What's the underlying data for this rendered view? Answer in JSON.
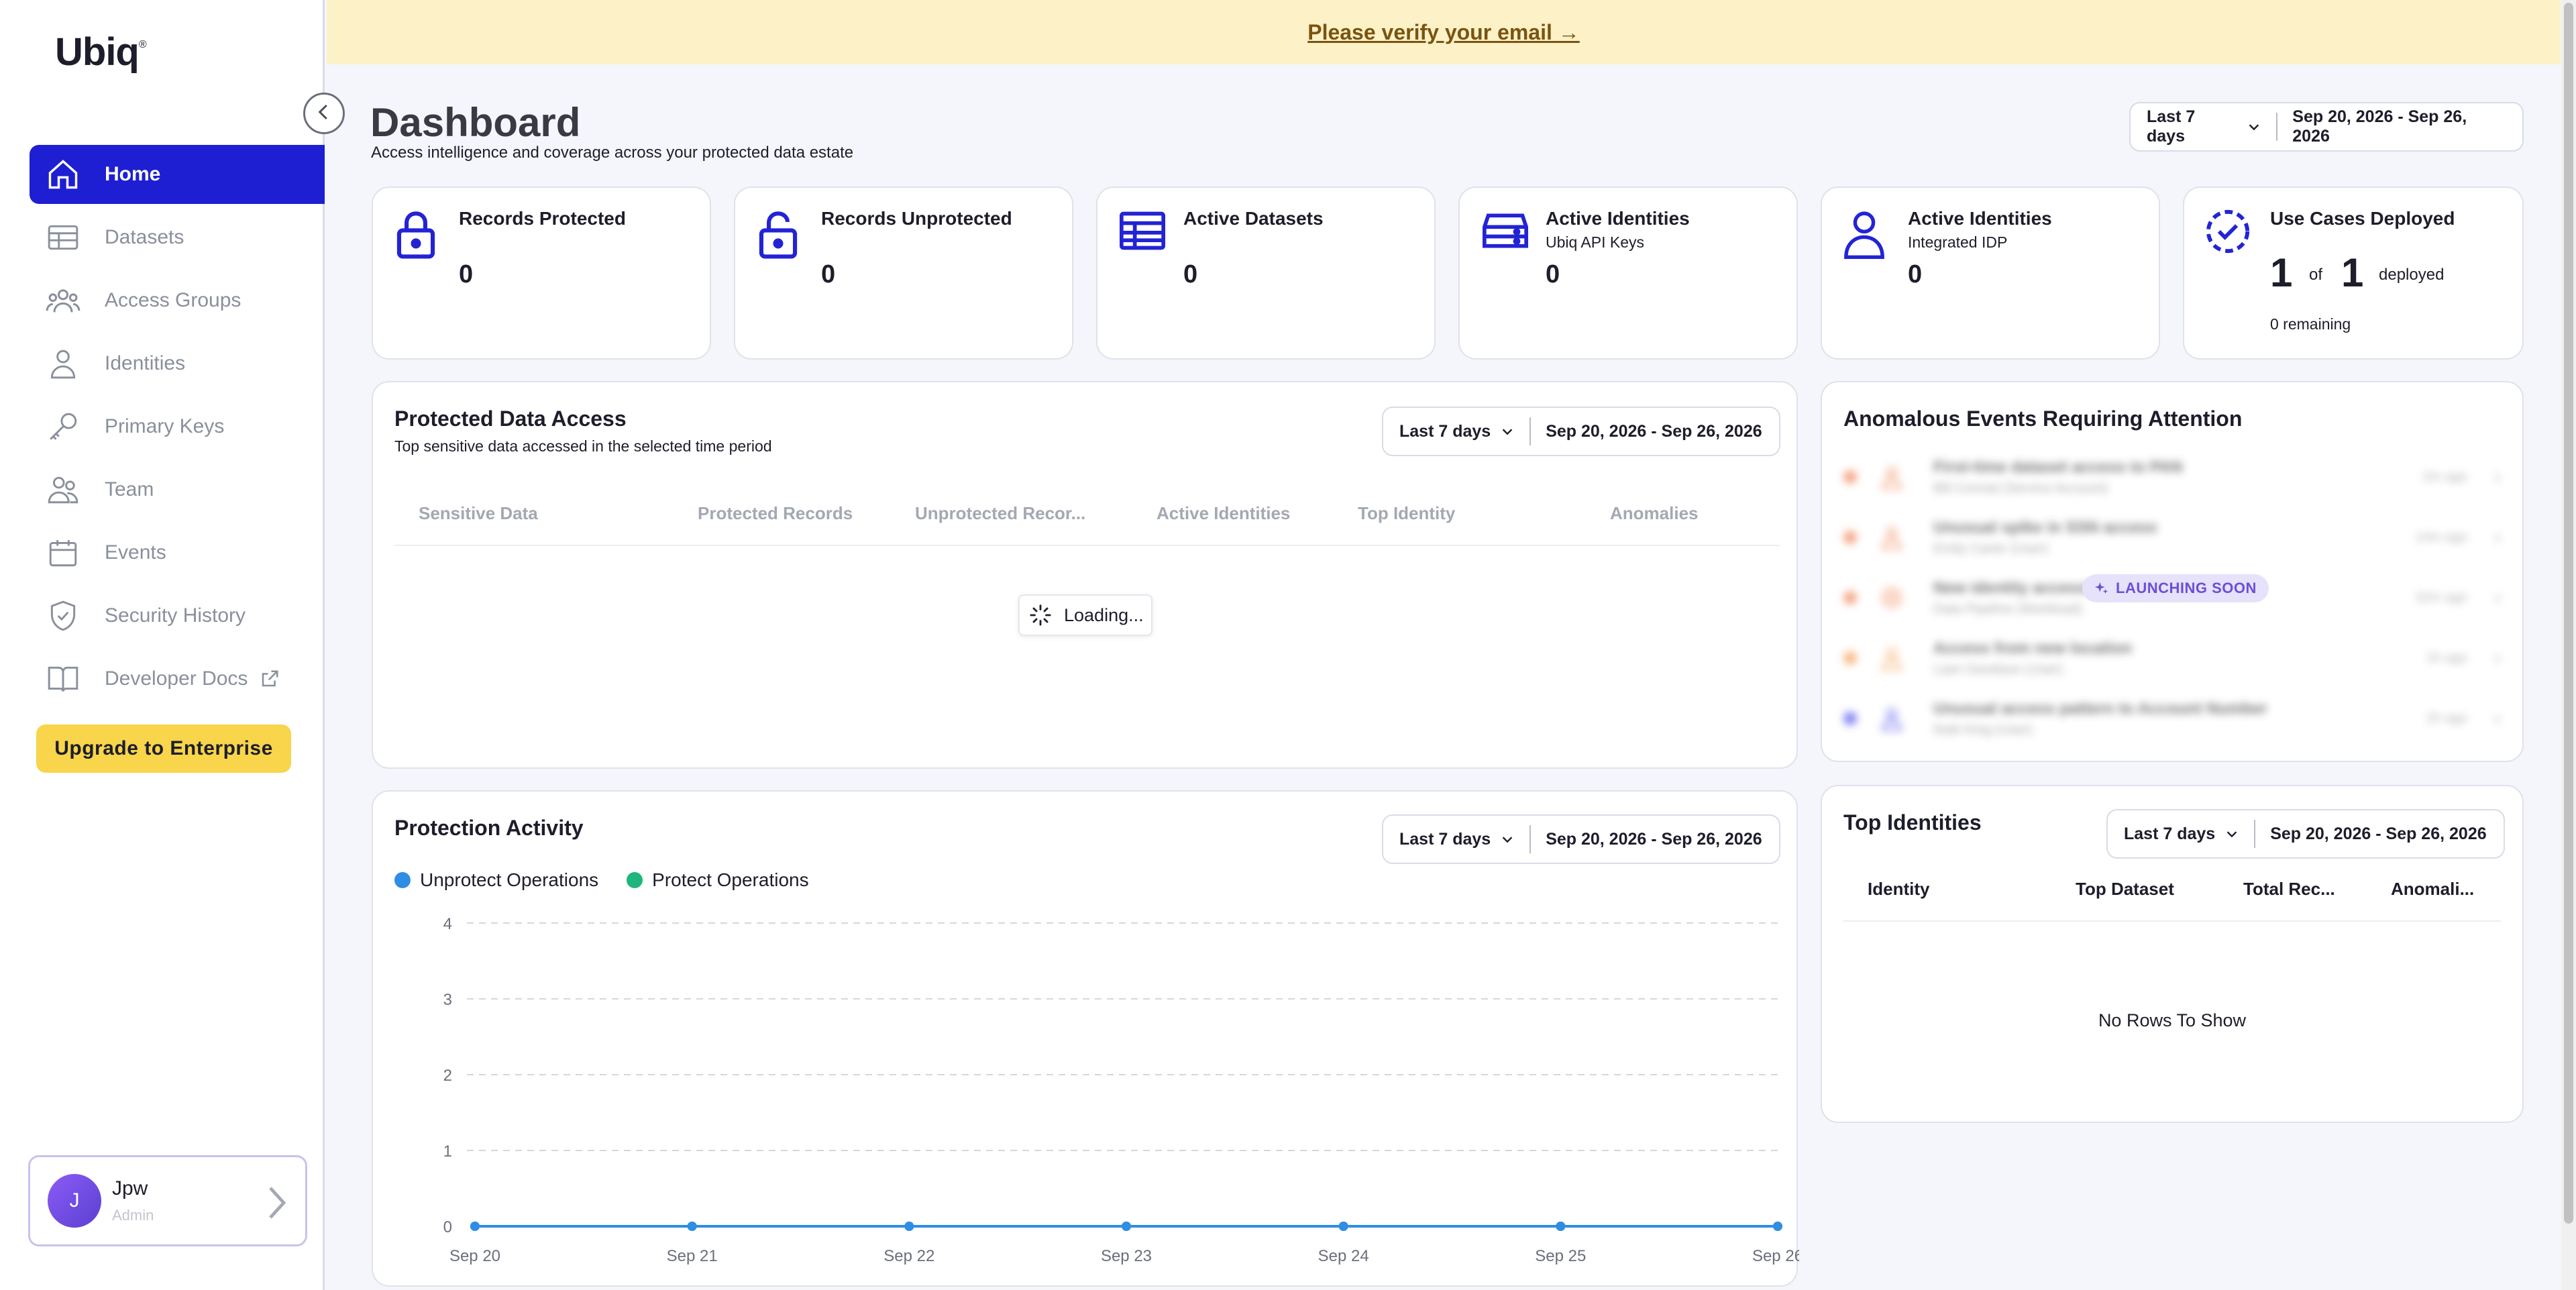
{
  "banner": {
    "text": "Please verify your email →"
  },
  "sidebar": {
    "logo": "Ubiq",
    "logo_mark": "®",
    "items": [
      {
        "label": "Home",
        "icon": "home-icon",
        "active": true
      },
      {
        "label": "Datasets",
        "icon": "table-icon"
      },
      {
        "label": "Access Groups",
        "icon": "group-icon"
      },
      {
        "label": "Identities",
        "icon": "person-icon"
      },
      {
        "label": "Primary Keys",
        "icon": "key-icon"
      },
      {
        "label": "Team",
        "icon": "team-icon"
      },
      {
        "label": "Events",
        "icon": "calendar-icon"
      },
      {
        "label": "Security History",
        "icon": "shield-check-icon"
      },
      {
        "label": "Developer Docs",
        "icon": "book-icon",
        "external": true
      }
    ],
    "upgrade_label": "Upgrade to Enterprise",
    "user": {
      "initial": "J",
      "name": "Jpw",
      "role": "Admin"
    }
  },
  "header": {
    "title": "Dashboard",
    "subtitle": "Access intelligence and coverage across your protected data estate",
    "range_preset": "Last 7 days",
    "range_dates": "Sep 20, 2026 - Sep 26, 2026"
  },
  "stats": [
    {
      "title": "Records Protected",
      "sub": "",
      "value": "0",
      "icon": "lock-icon"
    },
    {
      "title": "Records Unprotected",
      "sub": "",
      "value": "0",
      "icon": "unlock-icon"
    },
    {
      "title": "Active Datasets",
      "sub": "",
      "value": "0",
      "icon": "table-icon"
    },
    {
      "title": "Active Identities",
      "sub": "Ubiq API Keys",
      "value": "0",
      "icon": "server-icon"
    },
    {
      "title": "Active Identities",
      "sub": "Integrated IDP",
      "value": "0",
      "icon": "person-icon"
    }
  ],
  "use_cases": {
    "title": "Use Cases Deployed",
    "deployed": "1",
    "of_label": "of",
    "total": "1",
    "deployed_label": "deployed",
    "remaining": "0 remaining"
  },
  "protected_access": {
    "title": "Protected Data Access",
    "subtitle": "Top sensitive data accessed in the selected time period",
    "range_preset": "Last 7 days",
    "range_dates": "Sep 20, 2026 - Sep 26, 2026",
    "columns": [
      "Sensitive Data",
      "Protected Records",
      "Unprotected Recor...",
      "Active Identities",
      "Top Identity",
      "Anomalies"
    ],
    "loading": "Loading..."
  },
  "anomalies": {
    "title": "Anomalous Events Requiring Attention",
    "badge": "LAUNCHING SOON",
    "items": [
      {
        "title": "First-time dataset access to PAN",
        "who": "Bill Conrad (Service Account)",
        "time": "2m ago",
        "color": "#f08a5d"
      },
      {
        "title": "Unusual spike in SSN access",
        "who": "Emily Carter (User)",
        "time": "14m ago",
        "color": "#f08a5d"
      },
      {
        "title": "New identity accessing PII",
        "who": "Data Pipeline (Workload)",
        "time": "32m ago",
        "color": "#f08a5d"
      },
      {
        "title": "Access from new location",
        "who": "Liam Davidson (User)",
        "time": "1h ago",
        "color": "#f5a35a"
      },
      {
        "title": "Unusual access pattern to Account Number",
        "who": "Nobi King (User)",
        "time": "2h ago",
        "color": "#5b5bf0"
      }
    ]
  },
  "protection_activity": {
    "title": "Protection Activity",
    "range_preset": "Last 7 days",
    "range_dates": "Sep 20, 2026 - Sep 26, 2026"
  },
  "top_identities": {
    "title": "Top Identities",
    "range_preset": "Last 7 days",
    "range_dates": "Sep 20, 2026 - Sep 26, 2026",
    "columns": [
      "Identity",
      "Top Dataset",
      "Total Rec...",
      "Anomali..."
    ],
    "empty": "No Rows To Show"
  },
  "chart_data": {
    "type": "line",
    "title": "Protection Activity",
    "x": [
      "Sep 20",
      "Sep 21",
      "Sep 22",
      "Sep 23",
      "Sep 24",
      "Sep 25",
      "Sep 26"
    ],
    "ylim": [
      0,
      4
    ],
    "yticks": [
      0,
      1,
      2,
      3,
      4
    ],
    "grid": true,
    "legend": "top-left",
    "series": [
      {
        "name": "Unprotect Operations",
        "color": "#2f8de4",
        "values": [
          0,
          0,
          0,
          0,
          0,
          0,
          0
        ]
      },
      {
        "name": "Protect Operations",
        "color": "#1fb57e",
        "values": [
          0,
          0,
          0,
          0,
          0,
          0,
          0
        ]
      }
    ]
  }
}
